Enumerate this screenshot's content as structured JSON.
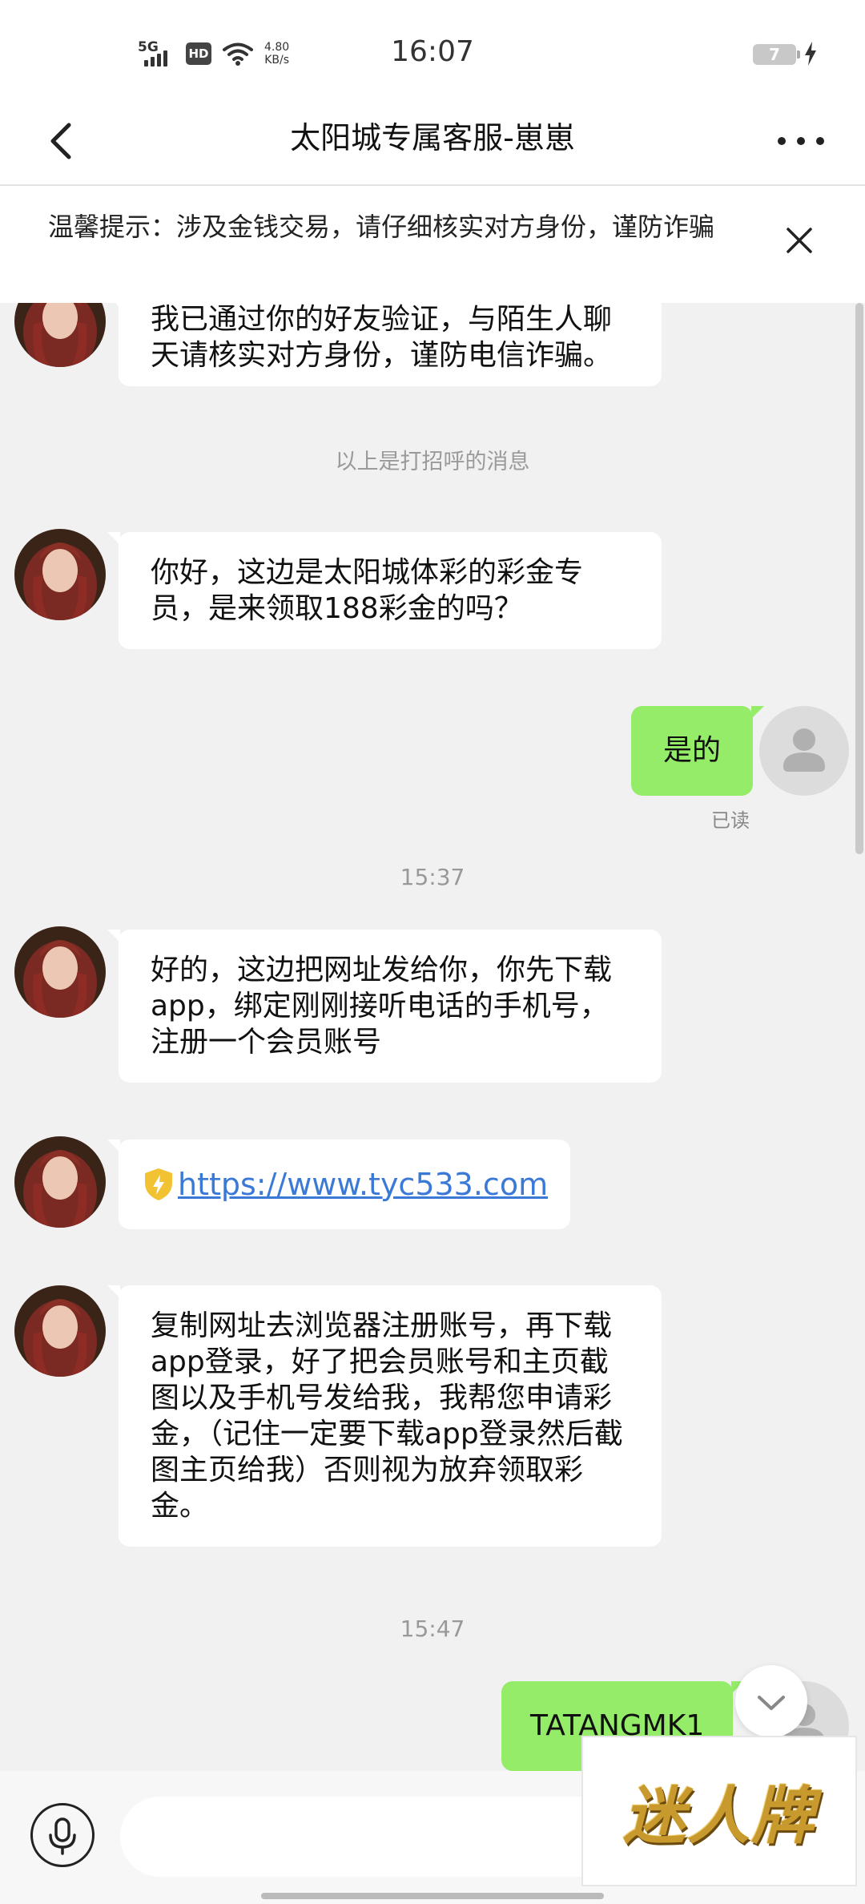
{
  "status_bar": {
    "network": "5G",
    "hd_label": "HD",
    "speed_value": "4.80",
    "speed_unit": "KB/s",
    "time": "16:07",
    "battery": "7"
  },
  "header": {
    "title": "太阳城专属客服-崽崽"
  },
  "notice": {
    "text": "温馨提示：涉及金钱交易，请仔细核实对方身份，谨防诈骗"
  },
  "messages": [
    {
      "from": "contact",
      "text": "我已通过你的好友验证，与陌生人聊天请核实对方身份，谨防电信诈骗。"
    },
    {
      "from": "system",
      "text": "以上是打招呼的消息"
    },
    {
      "from": "contact",
      "text": "你好，这边是太阳城体彩的彩金专员，是来领取188彩金的吗？"
    },
    {
      "from": "me",
      "text": "是的",
      "status": "已读"
    },
    {
      "from": "time",
      "text": "15:37"
    },
    {
      "from": "contact",
      "text": "好的，这边把网址发给你，你先下载app，绑定刚刚接听电话的手机号，注册一个会员账号"
    },
    {
      "from": "contact",
      "text": "https://www.tyc533.com",
      "type": "link"
    },
    {
      "from": "contact",
      "text": "复制网址去浏览器注册账号，再下载app登录，好了把会员账号和主页截图以及手机号发给我，我帮您申请彩金，（记住一定要下载app登录然后截图主页给我）否则视为放弃领取彩金。"
    },
    {
      "from": "time",
      "text": "15:47"
    },
    {
      "from": "me",
      "text": "TATANGMK1"
    }
  ],
  "watermark": "迷人牌",
  "colors": {
    "outgoing_bubble": "#95ec69",
    "incoming_bubble": "#ffffff",
    "chat_background": "#f1f1f1",
    "link": "#3a7ad6"
  },
  "icons": {
    "back": "chevron-left-icon",
    "more": "more-horizontal-icon",
    "close": "close-icon",
    "voice": "microphone-icon",
    "link_security": "shield-lightning-icon",
    "scroll_down": "chevron-down-icon"
  }
}
